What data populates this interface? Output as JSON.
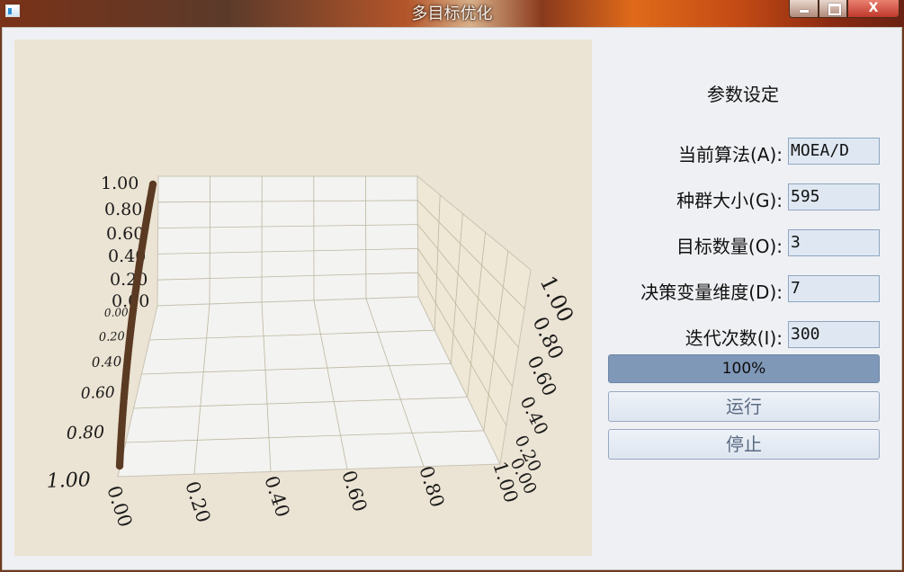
{
  "window": {
    "title": "多目标优化",
    "controls": {
      "minimize": "",
      "maximize": "",
      "close": "X"
    }
  },
  "settings": {
    "title": "参数设定",
    "fields": [
      {
        "label": "当前算法(A):",
        "value": "MOEA/D"
      },
      {
        "label": "种群大小(G):",
        "value": "595"
      },
      {
        "label": "目标数量(O):",
        "value": "3"
      },
      {
        "label": "决策变量维度(D):",
        "value": "7"
      },
      {
        "label": "迭代次数(I):",
        "value": "300"
      }
    ],
    "progress": {
      "value": 1.0,
      "text": "100%"
    },
    "run_label": "运行",
    "stop_label": "停止"
  },
  "chart_data": {
    "type": "scatter",
    "projection": "3d",
    "grid": true,
    "colors": {
      "points": "#5a3a22",
      "background": "#ebe3d3",
      "pane": "#f3f3f1"
    },
    "x_ticks": [
      "0.00",
      "0.20",
      "0.40",
      "0.60",
      "0.80",
      "1.00"
    ],
    "y_ticks": [
      "1.00",
      "0.80",
      "0.60",
      "0.40",
      "0.20",
      "0.00"
    ],
    "z_ticks": [
      "1.00",
      "0.80",
      "0.60",
      "0.40",
      "0.20",
      "0.00"
    ],
    "right_ticks": [
      "1.00",
      "0.80",
      "0.60",
      "0.40",
      "0.20",
      "0.00"
    ],
    "xlim": [
      0,
      1
    ],
    "ylim": [
      0,
      1
    ],
    "zlim": [
      0,
      1
    ],
    "series": [
      {
        "x": [
          0,
          0,
          0,
          0,
          0,
          0,
          0,
          0,
          0,
          0,
          0
        ],
        "y": [
          1.0,
          0.9,
          0.8,
          0.7,
          0.6,
          0.5,
          0.4,
          0.3,
          0.2,
          0.1,
          0.0
        ],
        "z": [
          0.0,
          0.1,
          0.2,
          0.3,
          0.4,
          0.5,
          0.6,
          0.7,
          0.8,
          0.9,
          1.0
        ]
      }
    ]
  }
}
